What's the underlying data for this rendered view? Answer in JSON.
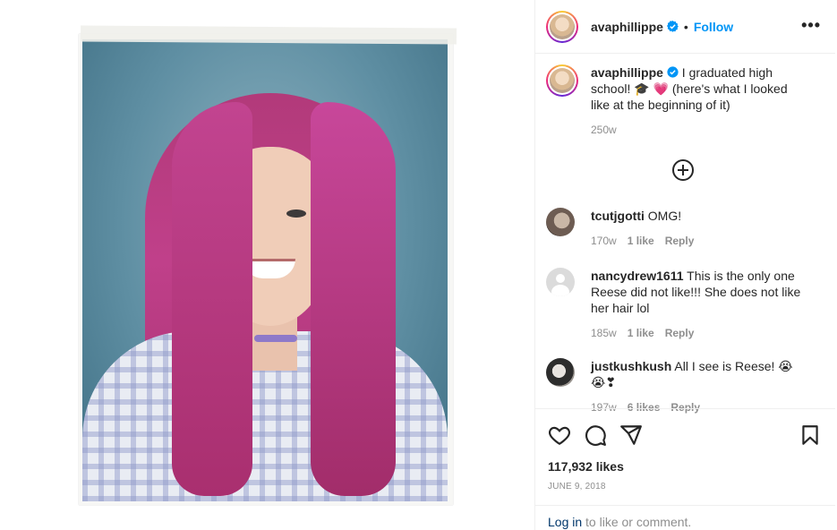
{
  "post": {
    "username": "avaphillippe",
    "follow_label": "Follow",
    "dot": "•",
    "more_icon": "more-horizontal-icon",
    "verified_color": "#0095f6"
  },
  "caption": {
    "username": "avaphillippe",
    "text": " I graduated high school! 🎓 💗 (here's what I looked like at the beginning of it)",
    "age": "250w"
  },
  "comments": [
    {
      "user": "tcutjgotti",
      "text": " OMG!",
      "age": "170w",
      "likes": "1 like",
      "reply": "Reply"
    },
    {
      "user": "nancydrew1611",
      "text": " This is the only one Reese did not like!!! She does not like her hair lol",
      "age": "185w",
      "likes": "1 like",
      "reply": "Reply"
    },
    {
      "user": "justkushkush",
      "text": " All I see is Reese! 😭 😭❣",
      "age": "197w",
      "likes": "6 likes",
      "reply": "Reply"
    }
  ],
  "stats": {
    "likes": "117,932 likes",
    "date": "JUNE 9, 2018"
  },
  "footer": {
    "login": "Log in",
    "rest": " to like or comment."
  }
}
